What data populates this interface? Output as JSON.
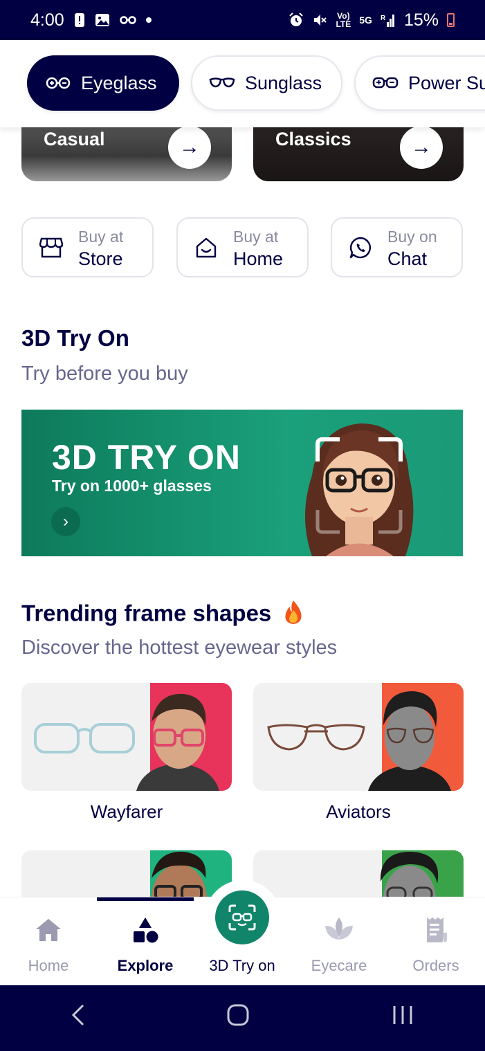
{
  "status_bar": {
    "time": "4:00",
    "battery": "15%",
    "small_a": "Vo)",
    "small_b": "LTE",
    "net": "5G"
  },
  "categories": [
    {
      "label": "Eyeglass",
      "icon": "eyeglass-icon",
      "active": true
    },
    {
      "label": "Sunglass",
      "icon": "sunglass-icon",
      "active": false
    },
    {
      "label": "Power Su",
      "icon": "power-sunglass-icon",
      "active": false
    }
  ],
  "top_cards": [
    {
      "label": "Casual"
    },
    {
      "label": "Classics"
    }
  ],
  "buy_options": [
    {
      "line1": "Buy at",
      "line2": "Store",
      "icon": "store-icon"
    },
    {
      "line1": "Buy at",
      "line2": "Home",
      "icon": "home-visit-icon"
    },
    {
      "line1": "Buy on",
      "line2": "Chat",
      "icon": "whatsapp-icon"
    }
  ],
  "try_on_section": {
    "title": "3D Try On",
    "subtitle": "Try before you buy",
    "banner": {
      "title": "3D TRY ON",
      "subtitle": "Try on 1000+ glasses"
    }
  },
  "trending_section": {
    "title": "Trending frame shapes",
    "subtitle": "Discover the hottest eyewear styles",
    "shapes": [
      {
        "label": "Wayfarer",
        "accent": "#e8345a"
      },
      {
        "label": "Aviators",
        "accent": "#f25a3c"
      },
      {
        "label": "",
        "accent": "#1fb37f"
      },
      {
        "label": "",
        "accent": "#3aa34a"
      }
    ]
  },
  "bottom_nav": [
    {
      "label": "Home",
      "icon": "home-icon",
      "active": false
    },
    {
      "label": "Explore",
      "icon": "explore-icon",
      "active": true
    },
    {
      "label": "3D Try on",
      "icon": "face-scan-icon",
      "active": false
    },
    {
      "label": "Eyecare",
      "icon": "eyecare-leaf-icon",
      "active": false
    },
    {
      "label": "Orders",
      "icon": "orders-receipt-icon",
      "active": false
    }
  ],
  "colors": {
    "brand_navy": "#000042",
    "tryon_green": "#11856a",
    "muted_text": "#66668e"
  }
}
